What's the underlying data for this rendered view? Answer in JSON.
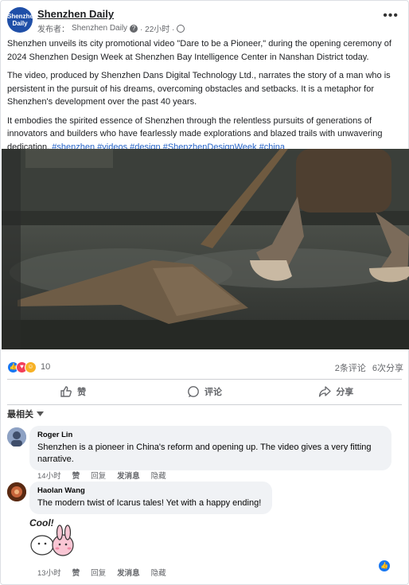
{
  "post": {
    "page_name": "Shenzhen Daily",
    "avatar_text": [
      "Shenzhen",
      "Daily"
    ],
    "meta_prefix": "发布者：",
    "meta_author": "Shenzhen Daily",
    "meta_time": "· 22小时 ·",
    "paragraphs": [
      "Shenzhen unveils its city promotional video \"Dare to be a Pioneer,\" during the opening ceremony of 2024 Shenzhen Design Week at Shenzhen Bay Intelligence Center in Nanshan District today.",
      "The video, produced by Shenzhen Dans Digital Technology Ltd., narrates the story of a man who is persistent in the pursuit of his dreams, overcoming obstacles and setbacks. It is a metaphor for Shenzhen's development over the past 40 years.",
      "It embodies the spirited essence of Shenzhen through the relentless pursuits of generations of innovators and builders who have fearlessly made explorations and blazed trails with unwavering dedication."
    ],
    "hashtags": "#shenzhen #videos #design #ShenzhenDesignWeek #china"
  },
  "reactions": {
    "count": "10",
    "comments": "2条评论",
    "shares": "6次分享"
  },
  "actions": {
    "like": "赞",
    "comment": "评论",
    "share": "分享"
  },
  "sort_label": "最相关",
  "sticker_text": "Cool!",
  "comments": [
    {
      "name": "Roger Lin",
      "text": "Shenzhen is a pioneer in China's reform and opening up. The video gives a very fitting narrative.",
      "time": "14小时",
      "like": "赞",
      "reply": "回复",
      "message": "发消息",
      "hide": "隐藏"
    },
    {
      "name": "Haolan Wang",
      "text": "The modern twist of Icarus tales! Yet with a happy ending!",
      "time": "13小时",
      "like": "赞",
      "reply": "回复",
      "message": "发消息",
      "hide": "隐藏"
    }
  ],
  "colors": {
    "hashtag": "#2563c7",
    "like_react": "#1877f2",
    "love_react": "#f33e58",
    "haha_react": "#f7b125"
  },
  "icons": [
    "question-icon",
    "globe-icon",
    "more-options-icon",
    "like-icon",
    "comment-icon",
    "share-icon",
    "chevron-down-icon"
  ]
}
